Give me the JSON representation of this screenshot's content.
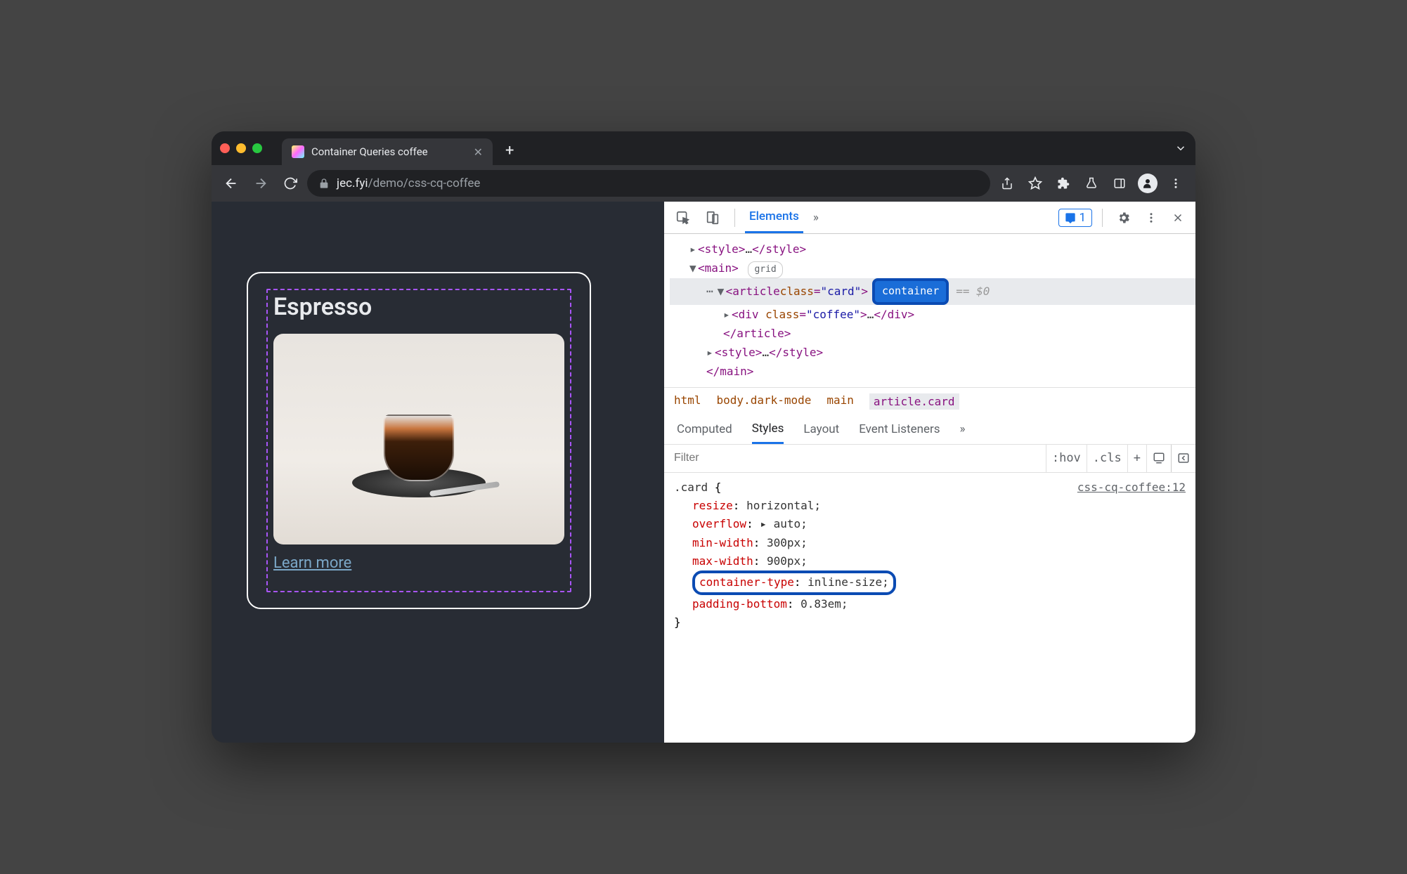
{
  "tab": {
    "title": "Container Queries coffee"
  },
  "url": {
    "domain": "jec.fyi",
    "path": "/demo/css-cq-coffee"
  },
  "page": {
    "card_title": "Espresso",
    "learn_more": "Learn more"
  },
  "devtools": {
    "tabs": {
      "elements": "Elements"
    },
    "issues_count": "1",
    "dom": {
      "style_open": "<style>",
      "style_ell": "…",
      "style_close": "</style>",
      "main_open": "<main>",
      "main_badge": "grid",
      "article_open_1": "<article ",
      "article_attr_n": "class",
      "article_attr_v": "\"card\"",
      "article_open_2": ">",
      "container_badge": "container",
      "eq0": "== $0",
      "div_open_1": "<div ",
      "div_attr_n": "class",
      "div_attr_v": "\"coffee\"",
      "div_open_2": ">",
      "div_ell": "…",
      "div_close": "</div>",
      "article_close": "</article>",
      "style2_open": "<style>",
      "style2_ell": "…",
      "style2_close": "</style>",
      "main_close": "</main>"
    },
    "crumb": {
      "a": "html",
      "b": "body.dark-mode",
      "c": "main",
      "d": "article.card"
    },
    "styles_tabs": {
      "computed": "Computed",
      "styles": "Styles",
      "layout": "Layout",
      "ev": "Event Listeners"
    },
    "filter": {
      "placeholder": "Filter",
      "hov": ":hov",
      "cls": ".cls"
    },
    "rule": {
      "selector": ".card",
      "source": "css-cq-coffee:12",
      "open": " {",
      "close": "}",
      "decls": [
        {
          "p": "resize",
          "v": "horizontal;"
        },
        {
          "p": "overflow",
          "v": "▸ auto;"
        },
        {
          "p": "min-width",
          "v": "300px;"
        },
        {
          "p": "max-width",
          "v": "900px;"
        },
        {
          "p": "container-type",
          "v": "inline-size;",
          "hl": true
        },
        {
          "p": "padding-bottom",
          "v": "0.83em;"
        }
      ]
    }
  }
}
